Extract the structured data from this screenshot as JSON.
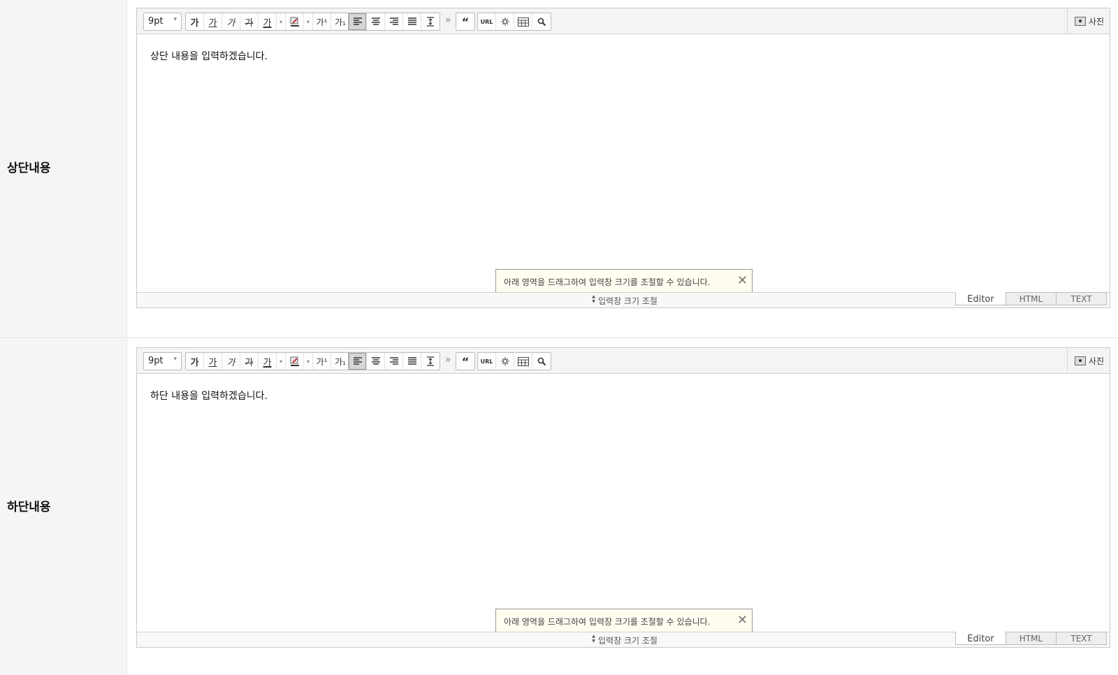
{
  "sections": [
    {
      "label": "상단내용",
      "font_size": "9pt",
      "content": "상단 내용을 입력하겠습니다.",
      "tooltip": "아래 영역을 드래그하여 입력창 크기를 조절할 수 있습니다.",
      "resize_label": "입력창 크기 조절",
      "photo_label": "사진"
    },
    {
      "label": "하단내용",
      "font_size": "9pt",
      "content": "하단 내용을 입력하겠습니다.",
      "tooltip": "아래 영역을 드래그하여 입력창 크기를 조절할 수 있습니다.",
      "resize_label": "입력창 크기 조절",
      "photo_label": "사진"
    }
  ],
  "toolbar": {
    "bold": "가",
    "underline": "가",
    "italic": "가",
    "strike": "가",
    "font_color": "가",
    "superscript": "가¹",
    "subscript": "가₁",
    "url": "URL",
    "more": "»",
    "quote": "“"
  },
  "modes": [
    "Editor",
    "HTML",
    "TEXT"
  ],
  "icons": [
    "caret-down-icon",
    "highlight-icon",
    "align-left-icon",
    "align-center-icon",
    "align-right-icon",
    "align-justify-icon",
    "line-height-icon",
    "quote-icon",
    "special-char-icon",
    "table-icon",
    "search-icon",
    "photo-icon",
    "close-icon",
    "resize-arrows-icon"
  ]
}
